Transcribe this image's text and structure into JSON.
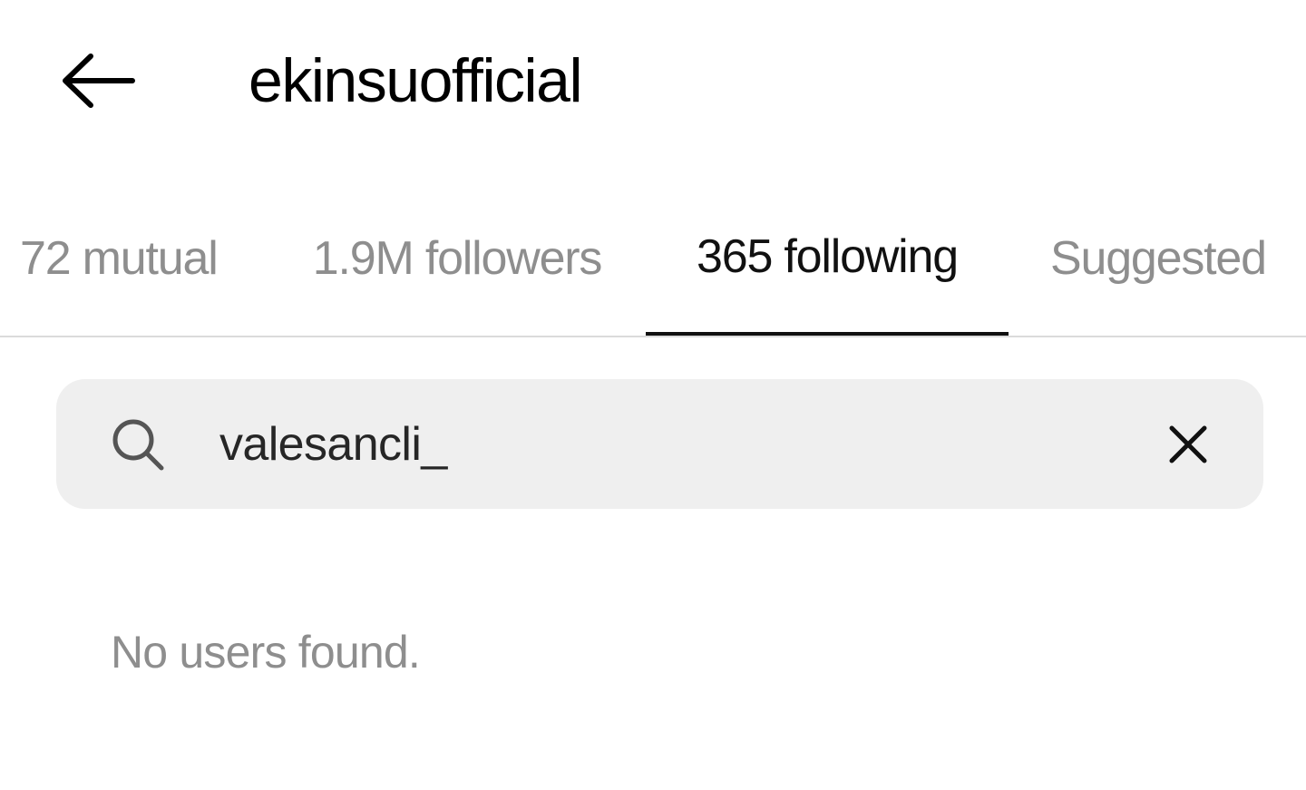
{
  "header": {
    "back_icon": "arrow-left-icon",
    "title": "ekinsuofficial"
  },
  "tabs": [
    {
      "label": "72 mutual",
      "active": false
    },
    {
      "label": "1.9M followers",
      "active": false
    },
    {
      "label": "365 following",
      "active": true
    },
    {
      "label": "Suggested",
      "active": false
    }
  ],
  "search": {
    "icon": "search-icon",
    "value": "valesancli_",
    "clear_icon": "close-icon"
  },
  "results": {
    "empty_message": "No users found."
  },
  "colors": {
    "background": "#ffffff",
    "text_primary": "#000000",
    "text_muted": "#8e8e8e",
    "search_background": "#efefef",
    "divider": "#dbdbdb",
    "active_indicator": "#111111"
  }
}
